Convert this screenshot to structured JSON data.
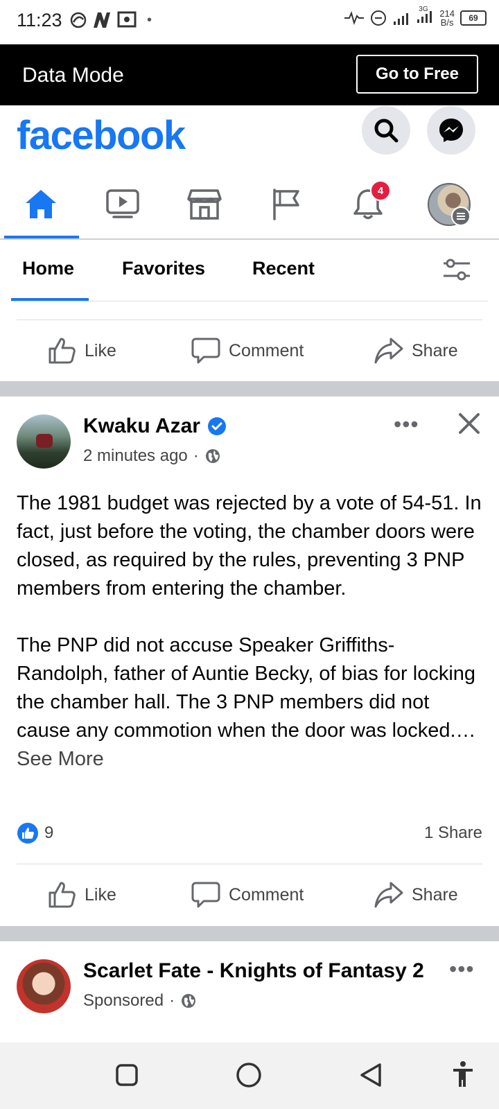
{
  "status_bar": {
    "time": "11:23",
    "net_speed_value": "214",
    "net_speed_unit": "B/s",
    "battery": "69",
    "network_type": "3G"
  },
  "data_mode": {
    "title": "Data Mode",
    "go_free_label": "Go to Free"
  },
  "header": {
    "logo": "facebook",
    "search_icon": "search-icon",
    "messenger_icon": "messenger-icon"
  },
  "nav": {
    "items": [
      {
        "icon": "home-icon",
        "active": true
      },
      {
        "icon": "video-icon"
      },
      {
        "icon": "marketplace-icon"
      },
      {
        "icon": "pages-flag-icon"
      },
      {
        "icon": "notifications-bell-icon",
        "badge": "4"
      },
      {
        "icon": "profile-menu-icon"
      }
    ]
  },
  "tabs": {
    "home": "Home",
    "favorites": "Favorites",
    "recent": "Recent",
    "filter_icon": "filter-settings-icon"
  },
  "actions": {
    "like": "Like",
    "comment": "Comment",
    "share": "Share"
  },
  "post": {
    "author": "Kwaku Azar",
    "time": "2 minutes ago",
    "text": "The 1981 budget was rejected by a vote of 54-51. In fact, just before the voting, the chamber doors were closed, as required by the rules, preventing 3 PNP members from entering the chamber.\n\nThe PNP did not accuse Speaker Griffiths-Randolph, father of Auntie Becky, of bias for locking the chamber hall. The 3 PNP members did not cause any commotion when the door was locked.…",
    "see_more": "See More",
    "reactions": "9",
    "shares": "1 Share"
  },
  "sponsored_post": {
    "author": "Scarlet Fate - Knights of Fantasy 2",
    "label": "Sponsored"
  },
  "colors": {
    "brand": "#1877f2",
    "badge": "#e41e3f",
    "separator": "#c9ccd1"
  }
}
